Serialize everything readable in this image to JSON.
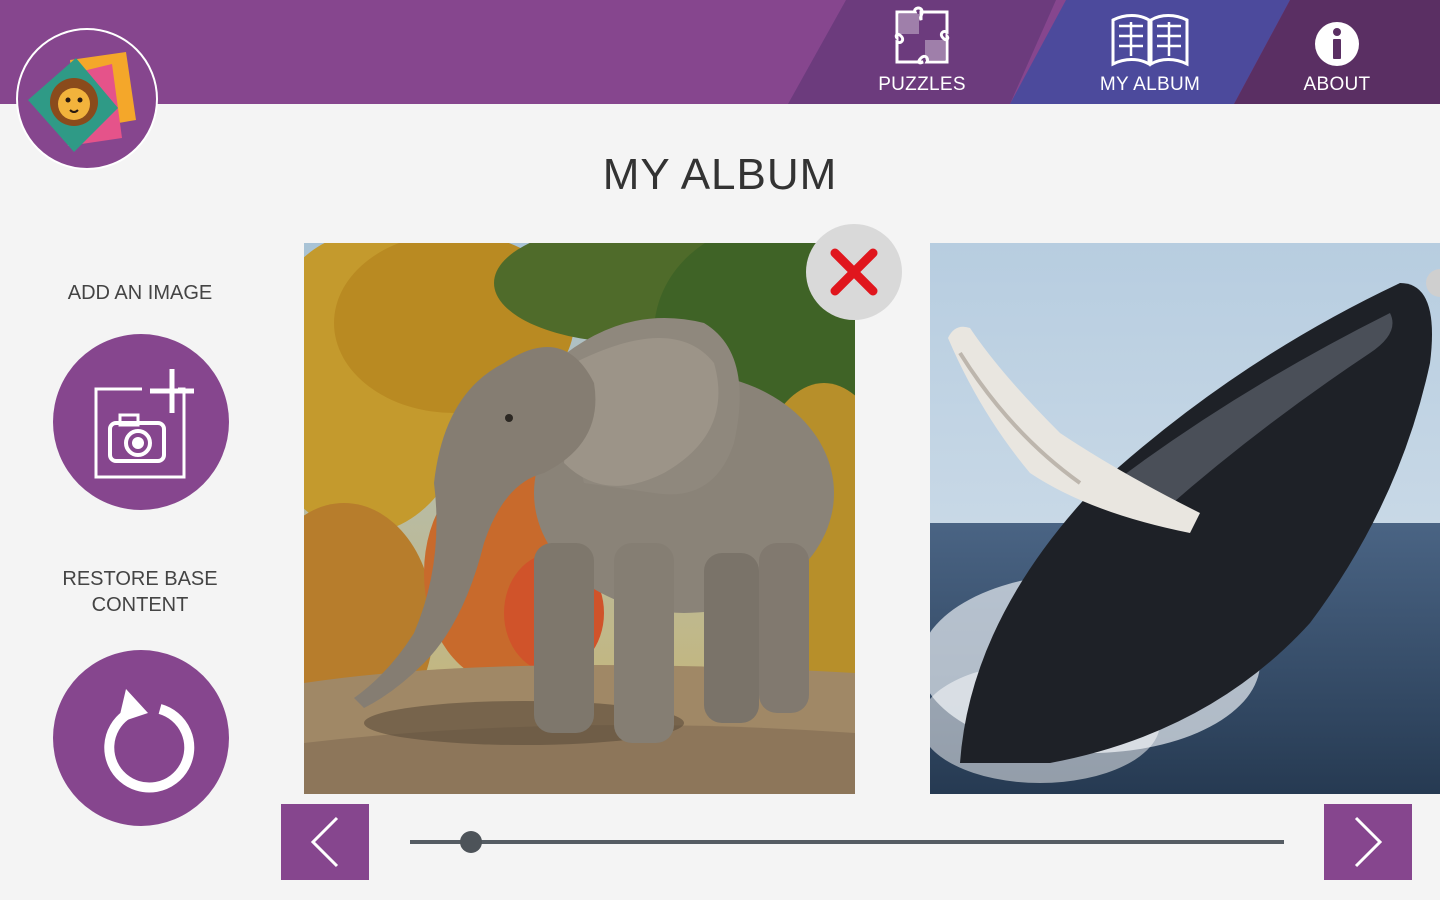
{
  "header": {
    "tabs": [
      {
        "id": "puzzles",
        "label": "PUZZLES",
        "icon": "puzzle-icon"
      },
      {
        "id": "my_album",
        "label": "MY ALBUM",
        "icon": "book-icon",
        "active": true
      },
      {
        "id": "about",
        "label": "ABOUT",
        "icon": "info-icon"
      }
    ]
  },
  "logo": {
    "icon": "lion-puzzle-logo"
  },
  "main": {
    "title": "MY ALBUM",
    "album_position": 0.07,
    "photos": [
      {
        "subject": "elephant",
        "deletable": true
      },
      {
        "subject": "humpback whale breaching"
      }
    ]
  },
  "sidebar": {
    "add_label": "ADD AN IMAGE",
    "restore_label_line1": "RESTORE BASE",
    "restore_label_line2": "CONTENT"
  },
  "colors": {
    "brand_purple": "#86468e",
    "tab_puzzles": "#6c3b7d",
    "tab_album_active": "#4c4a9c",
    "tab_about": "#5a2f63",
    "delete_red": "#e0161d",
    "background": "#f4f4f4"
  }
}
